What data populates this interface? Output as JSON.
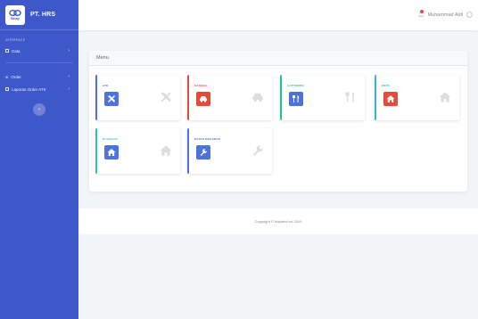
{
  "sidebar": {
    "brand_logo_text": "Bnay",
    "brand_name": "PT. HRS",
    "heading": "INTERFACE",
    "items": [
      {
        "label": "Data"
      },
      {
        "label": "Order"
      },
      {
        "label": "Laporan Order ATK"
      }
    ],
    "toggle_icon": "‹"
  },
  "topbar": {
    "user_name": "Muhammad Aldi"
  },
  "menu": {
    "title": "Menu",
    "tiles": [
      {
        "title": "ATK",
        "icon": "tools-icon",
        "accent": "#4e73df",
        "icon_bg": "#4e73df"
      },
      {
        "title": "SARANA",
        "icon": "car-icon",
        "accent": "#e74a3b",
        "icon_bg": "#e74a3b"
      },
      {
        "title": "CATTERING",
        "icon": "utensils-icon",
        "accent": "#1cc88a",
        "icon_bg": "#4e73df"
      },
      {
        "title": "MEPS",
        "icon": "home-icon",
        "accent": "#36b9cc",
        "icon_bg": "#e74a3b"
      },
      {
        "title": "RUANGAN",
        "icon": "home-icon",
        "accent": "#36b9cc",
        "icon_bg": "#4e73df"
      },
      {
        "title": "RATER MAKANAN",
        "icon": "wrench-icon",
        "accent": "#4e73df",
        "icon_bg": "#4e73df"
      }
    ]
  },
  "footer": {
    "copyright": "Copyright © Majaleni.nd 2019"
  },
  "colors": {
    "sidebar_bg": "#3f58c9",
    "primary": "#4e73df",
    "danger": "#e74a3b",
    "success": "#1cc88a",
    "info": "#36b9cc"
  }
}
